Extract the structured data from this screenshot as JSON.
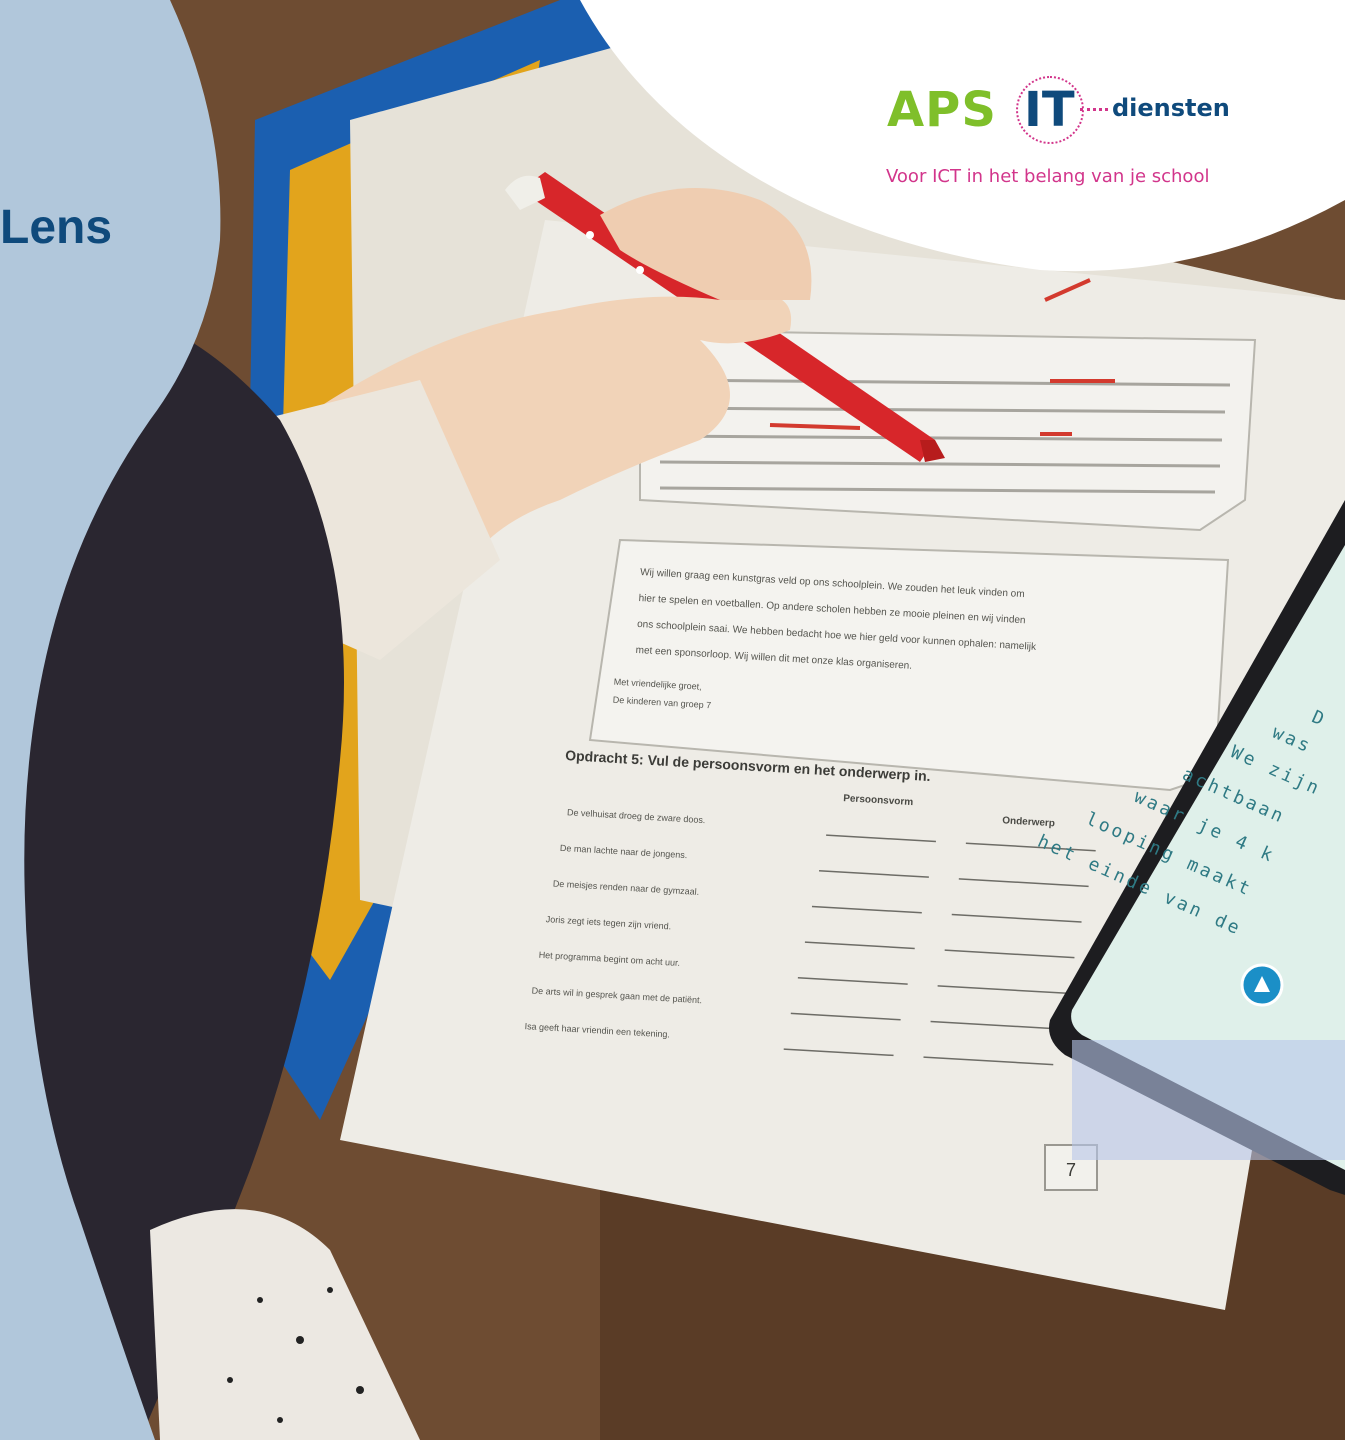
{
  "heading": "Lens",
  "logo": {
    "part1": "APS",
    "part2": "IT",
    "part3": "diensten",
    "tagline": "Voor ICT in het belang van je school",
    "colors": {
      "green": "#7fbf2a",
      "navy": "#0f4a7c",
      "magenta": "#d2358b"
    }
  },
  "worksheet": {
    "letter_lines": [
      "Wij willen graag een kunstgras veld op ons schoolplein. We zouden het leuk vinden om",
      "hier te spelen en voetballen. Op andere scholen hebben ze mooie pleinen en wij vinden",
      "ons schoolplein saai. We hebben bedacht hoe we hier geld voor kunnen ophalen: namelijk",
      "met een sponsorloop. Wij willen dit met onze klas organiseren."
    ],
    "closing": [
      "Met vriendelijke groet,",
      "De kinderen van groep 7"
    ],
    "exercise_title": "Opdracht 5: Vul de persoonsvorm en het onderwerp in.",
    "col1": "Persoonsvorm",
    "col2": "Onderwerp",
    "sentences": [
      "De velhuisat droeg de zware doos.",
      "De man lachte naar de jongens.",
      "De meisjes renden naar de gymzaal.",
      "Joris zegt iets tegen zijn vriend.",
      "Het programma begint om acht uur.",
      "De arts wil in gesprek gaan met de patiënt.",
      "Isa geeft haar vriendin een tekening."
    ],
    "page_number": "7"
  },
  "phone": {
    "lines": [
      "D",
      "was",
      "We zijn",
      "achtbaan",
      "waar je 4 k",
      "looping maakt",
      "het einde van de"
    ]
  }
}
